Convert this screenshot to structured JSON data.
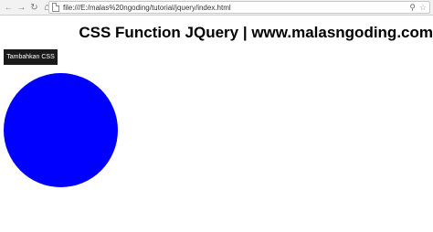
{
  "browser": {
    "back_icon": "arrow-left",
    "forward_icon": "arrow-right",
    "reload_icon": "reload",
    "home_icon": "home",
    "url": "file:///E:/malas%20ngoding/tutorial/jquery/index.html",
    "search_icon": "magnifier",
    "bookmark_icon": "star"
  },
  "page": {
    "heading": "CSS Function JQuery | www.malasngoding.com",
    "button_label": "Tambahkan CSS",
    "circle_color": "#0000ff"
  }
}
